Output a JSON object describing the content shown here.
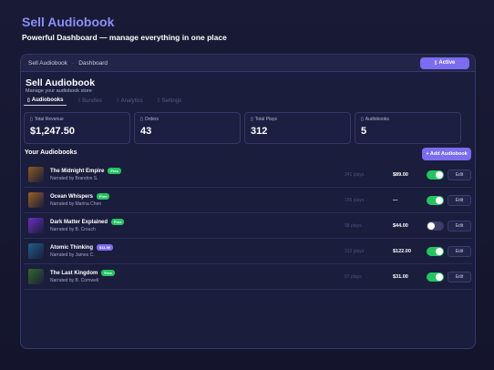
{
  "hero": {
    "title": "Sell Audiobook",
    "subtitle": "Powerful Dashboard — manage everything in one place"
  },
  "topbar": {
    "crumb_app": "Sell Audiobook",
    "crumb_sep": "·",
    "crumb_page": "Dashboard",
    "status_label": "Active",
    "status_icon": "status-dot-icon"
  },
  "app": {
    "title": "Sell Audiobook",
    "subtitle": "Manage your audiobook store"
  },
  "tabs": [
    {
      "label": "Audiobooks",
      "icon": "book-icon",
      "active": true
    },
    {
      "label": "Bundles",
      "icon": "bundle-icon",
      "active": false
    },
    {
      "label": "Analytics",
      "icon": "chart-icon",
      "active": false
    },
    {
      "label": "Settings",
      "icon": "gear-icon",
      "active": false
    }
  ],
  "stats": [
    {
      "label": "Total Revenue",
      "value": "$1,247.50",
      "icon": "revenue-icon"
    },
    {
      "label": "Orders",
      "value": "43",
      "icon": "orders-icon"
    },
    {
      "label": "Total Plays",
      "value": "312",
      "icon": "plays-icon"
    },
    {
      "label": "Audiobooks",
      "value": "5",
      "icon": "audiobooks-icon"
    }
  ],
  "list": {
    "title": "Your Audiobooks",
    "add_label": "+ Add Audiobook",
    "edit_label": "Edit"
  },
  "books": [
    {
      "title": "The Midnight Empire",
      "badge": "Free",
      "narrator": "Narrated by Brandon S.",
      "plays": "241 plays",
      "price": "$89.00",
      "enabled": true,
      "cover_color": "#8a5a1c"
    },
    {
      "title": "Ocean Whispers",
      "badge": "Free",
      "narrator": "Narrated by Marina Chen",
      "plays": "156 plays",
      "price": "—",
      "enabled": true,
      "cover_color": "#9a6020"
    },
    {
      "title": "Dark Matter Explained",
      "badge": "Free",
      "narrator": "Narrated by B. Crouch",
      "plays": "98 plays",
      "price": "$44.00",
      "enabled": false,
      "cover_color": "#6a2fc0"
    },
    {
      "title": "Atomic Thinking",
      "badge": "$11.99",
      "narrator": "Narrated by James C.",
      "plays": "312 plays",
      "price": "$122.00",
      "enabled": true,
      "cover_color": "#1f5f86"
    },
    {
      "title": "The Last Kingdom",
      "badge": "Free",
      "narrator": "Narrated by B. Cornwell",
      "plays": "67 plays",
      "price": "$31.00",
      "enabled": true,
      "cover_color": "#2f6a2a"
    }
  ],
  "colors": {
    "accent": "#7b6cf0",
    "badge_free": "#22c55e",
    "badge_price": "#7b6cf0",
    "toggle_on": "#22c55e",
    "toggle_off": "#3b3e66"
  }
}
